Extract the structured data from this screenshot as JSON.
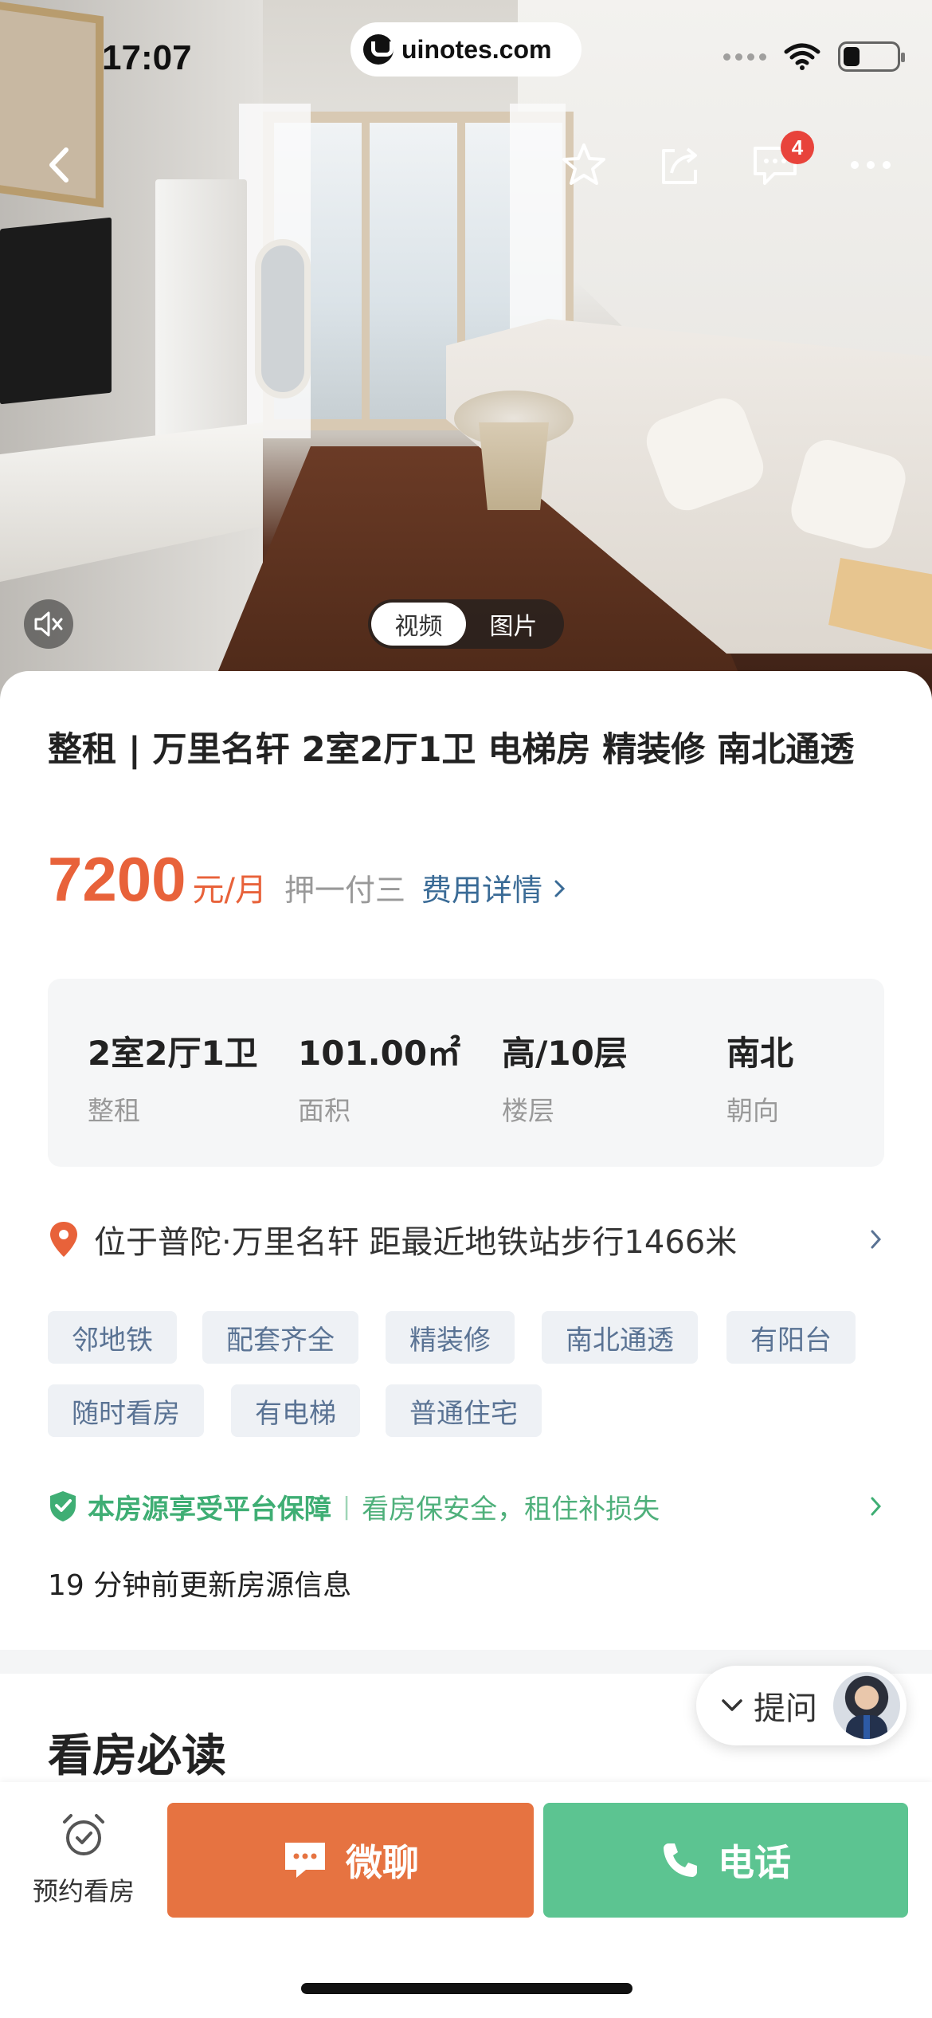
{
  "status_bar": {
    "time": "17:07",
    "url": "uinotes.com"
  },
  "nav": {
    "badge_count": "4"
  },
  "media": {
    "video_label": "视频",
    "photo_label": "图片",
    "active": "video"
  },
  "listing": {
    "title": "整租 | 万里名轩 2室2厅1卫 电梯房 精装修 南北通透",
    "price": "7200",
    "price_unit": "元/月",
    "deposit": "押一付三",
    "fee_link": "费用详情",
    "specs": [
      {
        "value": "2室2厅1卫",
        "key": "整租"
      },
      {
        "value": "101.00㎡",
        "key": "面积"
      },
      {
        "value": "高/10层",
        "key": "楼层"
      },
      {
        "value": "南北",
        "key": "朝向"
      }
    ],
    "location": "位于普陀·万里名轩 距最近地铁站步行1466米",
    "tags": [
      "邻地铁",
      "配套齐全",
      "精装修",
      "南北通透",
      "有阳台",
      "随时看房",
      "有电梯",
      "普通住宅"
    ],
    "guarantee_strong": "本房源享受平台保障",
    "guarantee_sep": "|",
    "guarantee_text": "看房保安全，租住补损失",
    "updated": "19 分钟前更新房源信息"
  },
  "section": {
    "title": "看房必读"
  },
  "ask": {
    "label": "提问"
  },
  "bottom": {
    "schedule_label": "预约看房",
    "chat_label": "微聊",
    "call_label": "电话"
  },
  "colors": {
    "accent_price": "#e8623a",
    "chat": "#e67341",
    "call": "#5cc491",
    "guarantee": "#3fae74",
    "link": "#3a6b96"
  }
}
